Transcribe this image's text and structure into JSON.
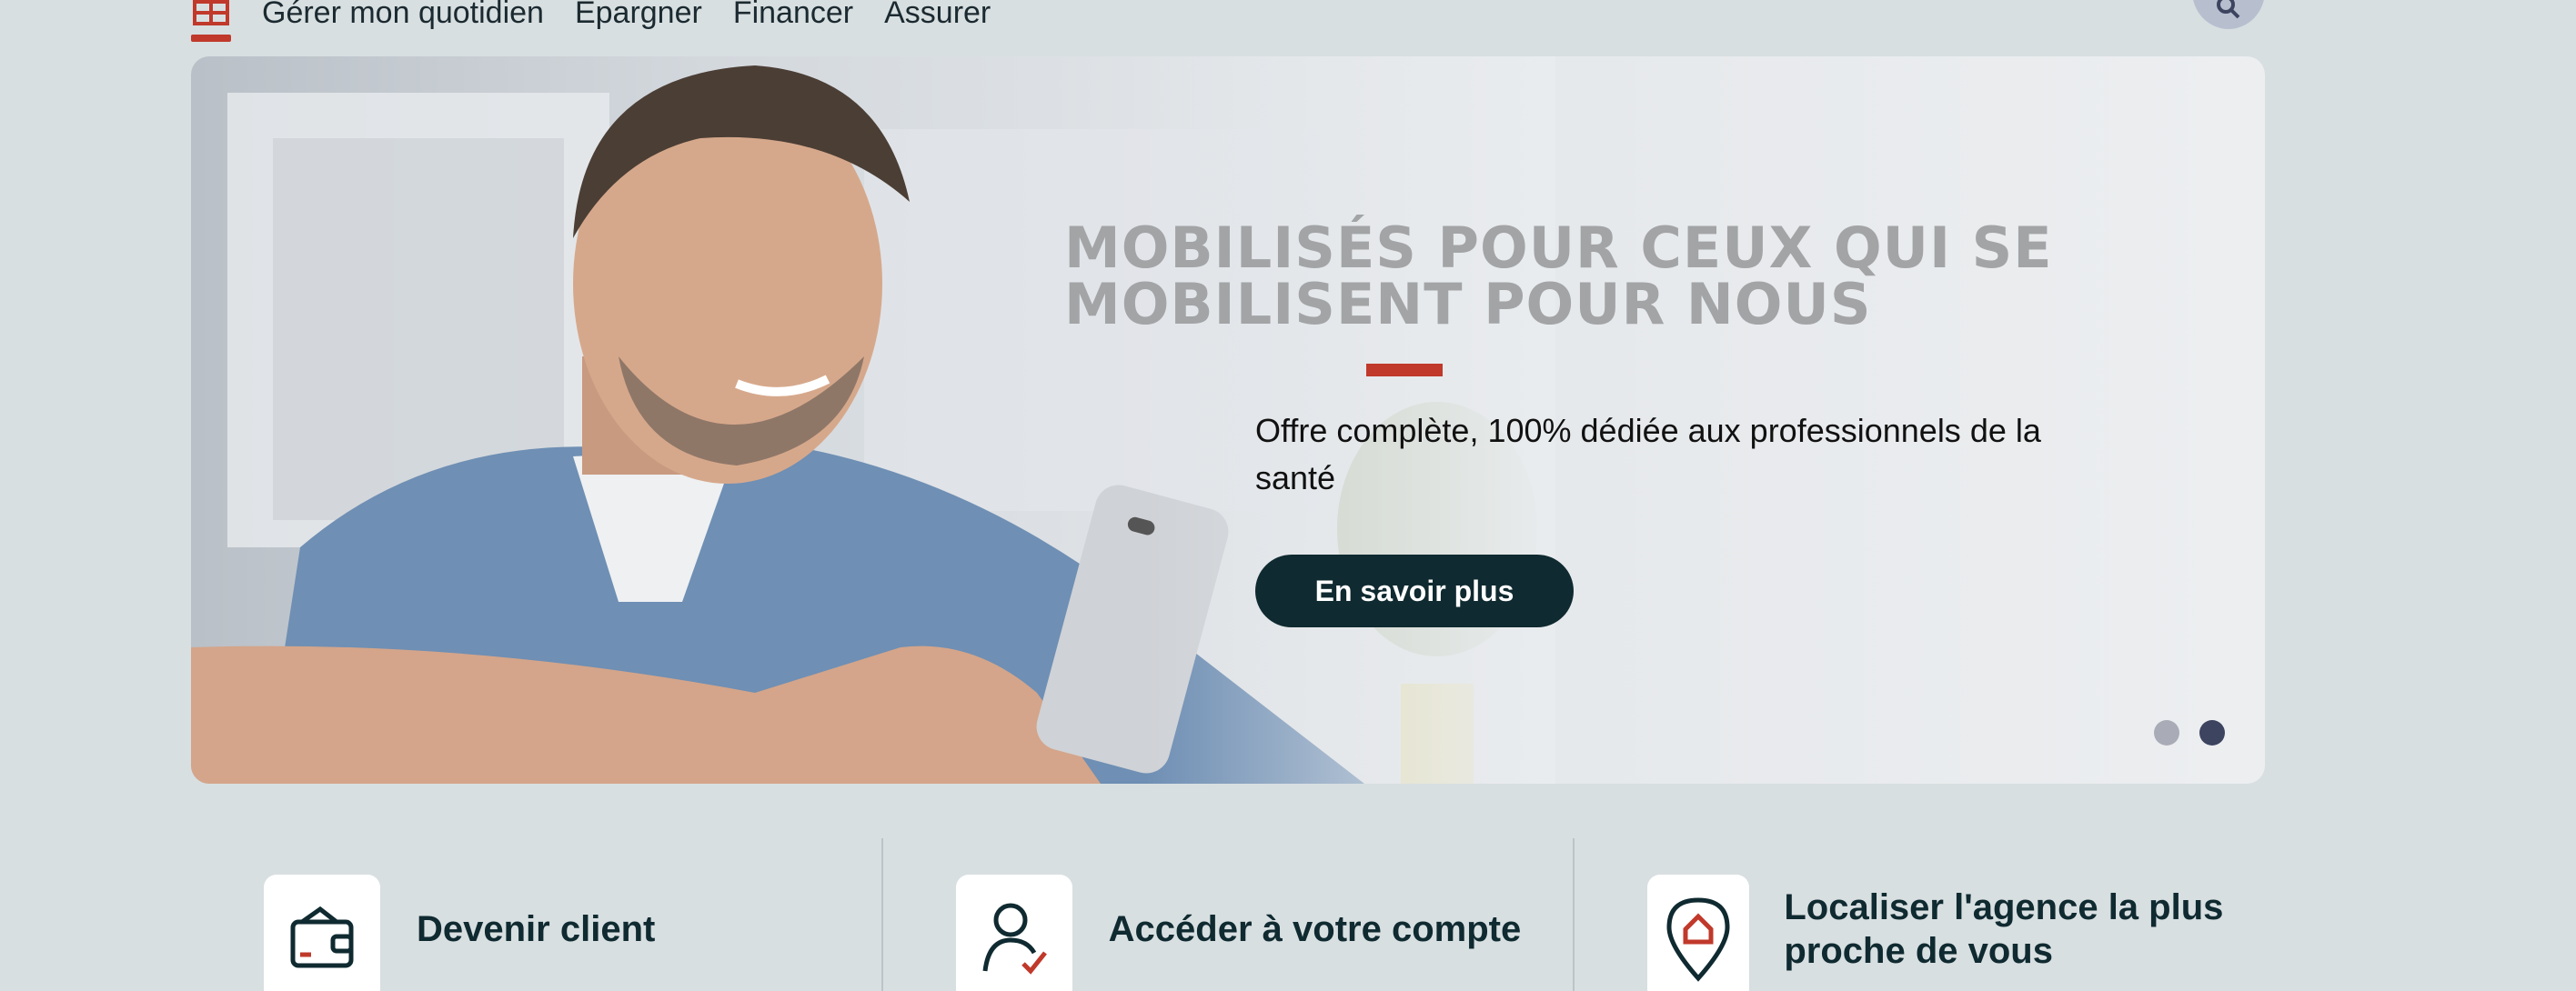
{
  "nav": {
    "items": [
      "Gérer mon quotidien",
      "Épargner",
      "Financer",
      "Assurer"
    ]
  },
  "hero": {
    "title_line1": "MOBILISÉS POUR CEUX QUI SE",
    "title_line2": "MOBILISENT POUR NOUS",
    "text": "Offre complète, 100% dédiée aux professionnels de la santé",
    "cta_label": "En savoir plus",
    "slides": {
      "count": 2,
      "active": 2
    }
  },
  "quick_links": [
    {
      "label": "Devenir client",
      "icon": "wallet-icon"
    },
    {
      "label": "Accéder à votre compte",
      "icon": "user-check-icon"
    },
    {
      "label": "Localiser l'agence la plus proche de vous",
      "icon": "location-home-icon"
    }
  ],
  "colors": {
    "accent": "#c0392b",
    "dark": "#0f2a30",
    "background": "#d8dfe1"
  }
}
